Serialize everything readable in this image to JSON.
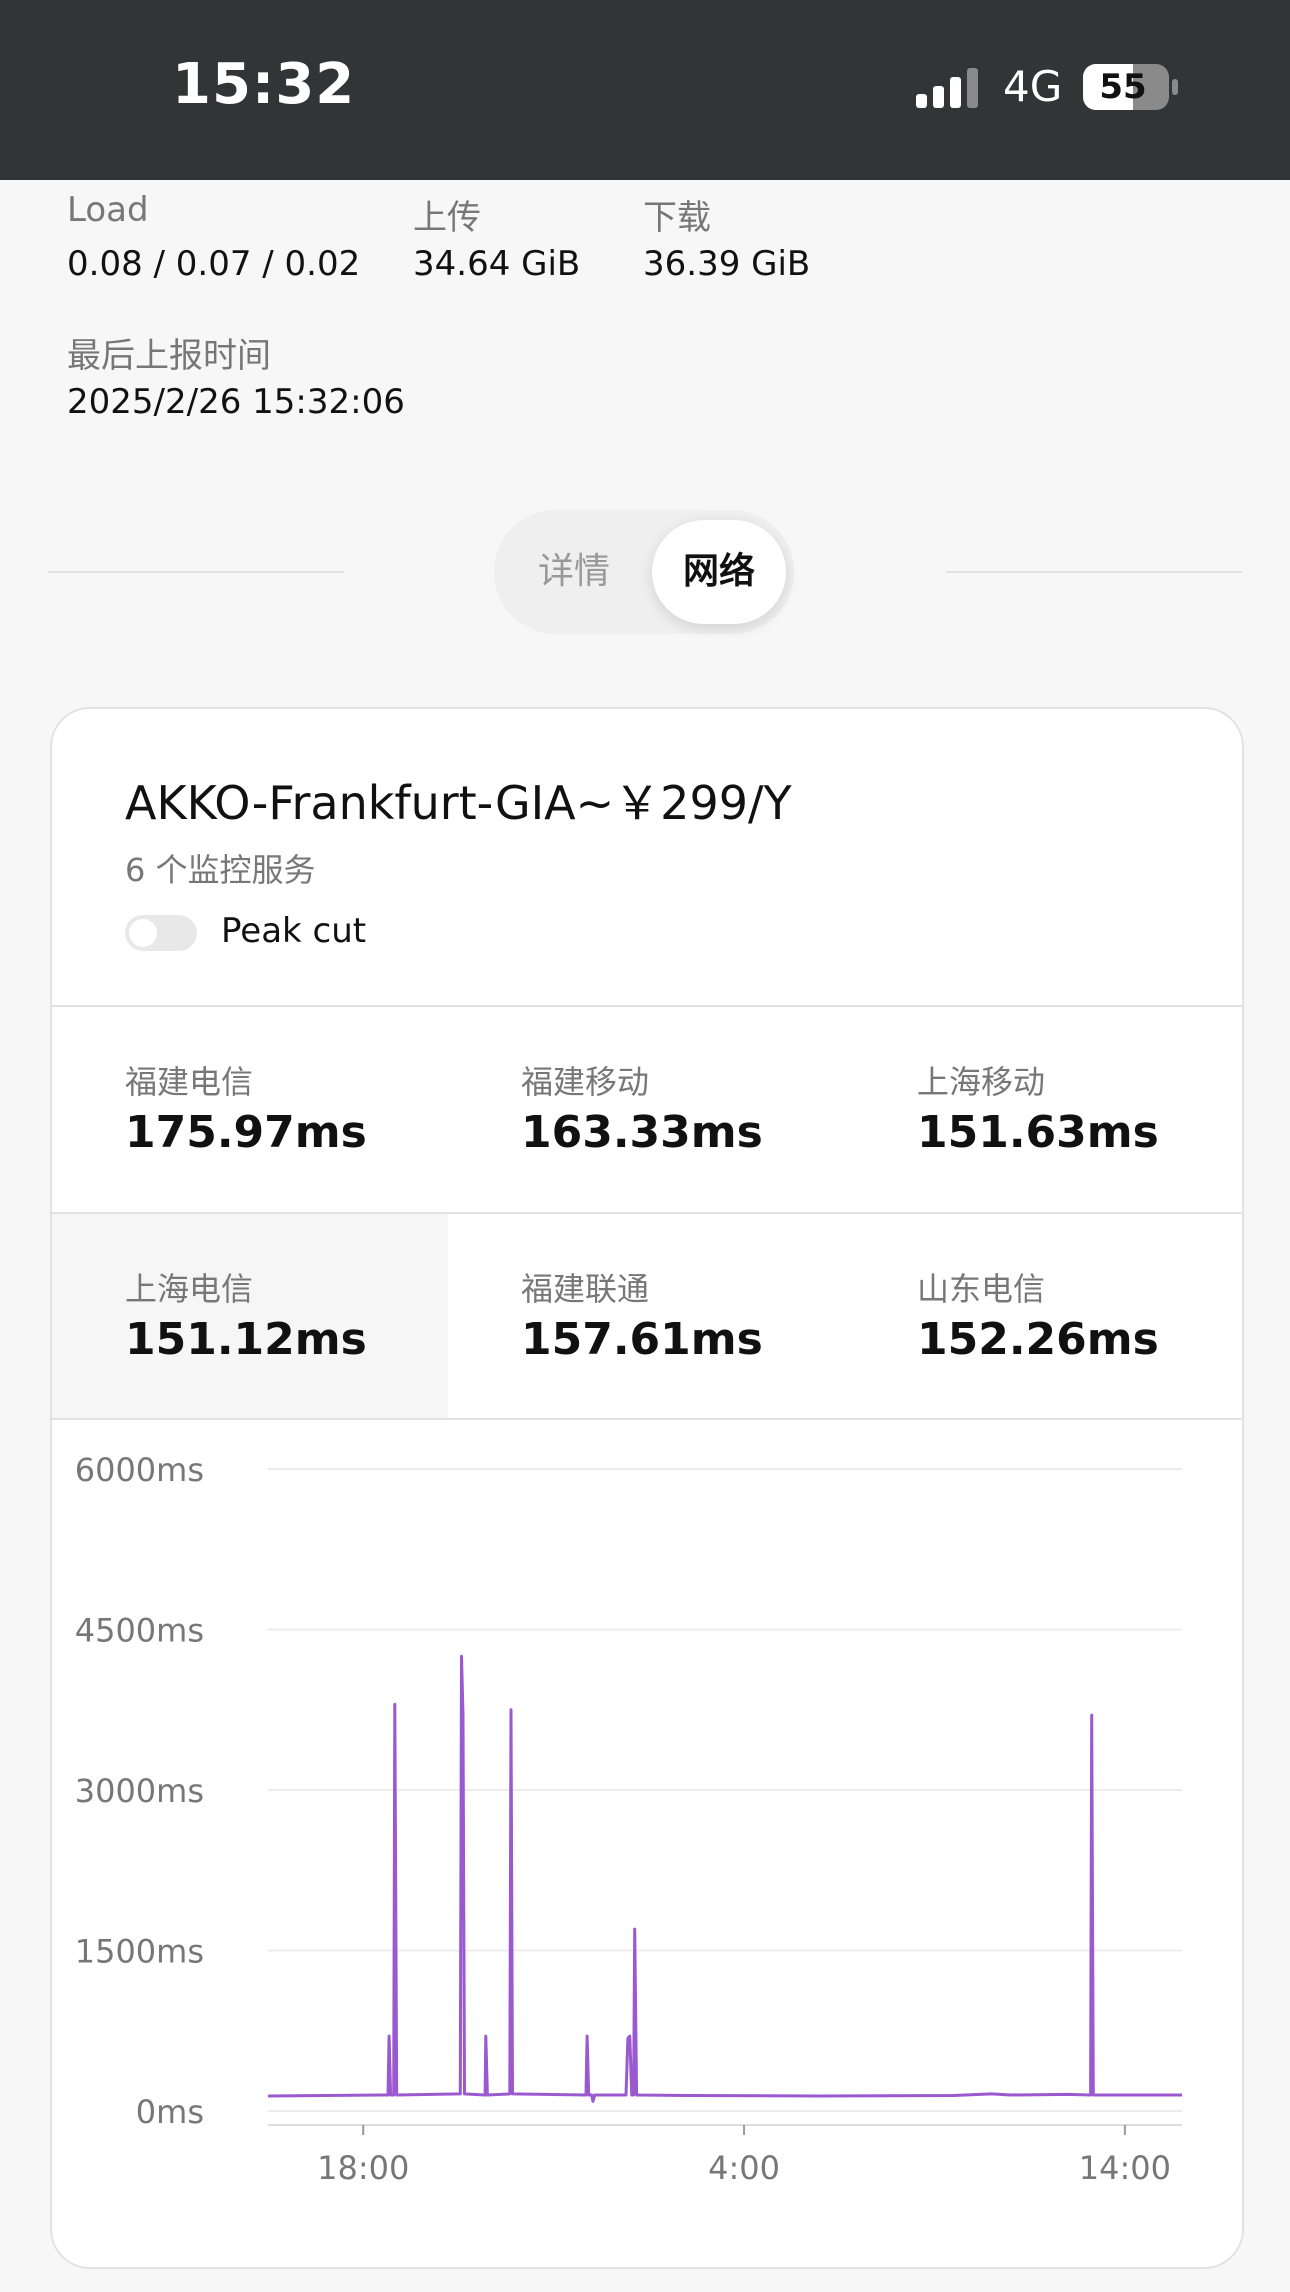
{
  "status_bar": {
    "time": "15:32",
    "network": "4G",
    "battery": "55"
  },
  "info": {
    "load_label": "Load",
    "load_value": "0.08 / 0.07 / 0.02",
    "upload_label": "上传",
    "upload_value": "34.64 GiB",
    "download_label": "下载",
    "download_value": "36.39 GiB",
    "last_report_label": "最后上报时间",
    "last_report_value": "2025/2/26 15:32:06"
  },
  "tabs": [
    {
      "label": "详情",
      "active": false
    },
    {
      "label": "网络",
      "active": true
    }
  ],
  "card": {
    "title": "AKKO-Frankfurt-GIA~￥299/Y",
    "subtitle": "6 个监控服务",
    "toggle_label": "Peak cut",
    "toggle_on": false,
    "services": [
      {
        "name": "福建电信",
        "value": "175.97ms",
        "active": false
      },
      {
        "name": "福建移动",
        "value": "163.33ms",
        "active": false
      },
      {
        "name": "上海移动",
        "value": "151.63ms",
        "active": false
      },
      {
        "name": "上海电信",
        "value": "151.12ms",
        "active": true
      },
      {
        "name": "福建联通",
        "value": "157.61ms",
        "active": false
      },
      {
        "name": "山东电信",
        "value": "152.26ms",
        "active": false
      }
    ]
  },
  "chart_data": {
    "type": "line",
    "ylim": [
      0,
      6000
    ],
    "y_ticks": [
      0,
      1500,
      3000,
      4500,
      6000
    ],
    "y_tick_labels": [
      "0ms",
      "1500ms",
      "3000ms",
      "4500ms",
      "6000ms"
    ],
    "x_ticks": [
      2.5,
      12.5,
      22.5
    ],
    "x_tick_labels": [
      "18:00",
      "4:00",
      "14:00"
    ],
    "xlim": [
      0,
      24
    ],
    "grid": true,
    "color": "#9b59d0",
    "series": [
      {
        "values": [
          [
            0,
            140
          ],
          [
            3.15,
            150
          ],
          [
            3.18,
            700
          ],
          [
            3.22,
            150
          ],
          [
            3.3,
            150
          ],
          [
            3.33,
            3800
          ],
          [
            3.38,
            150
          ],
          [
            5.05,
            160
          ],
          [
            5.08,
            4250
          ],
          [
            5.12,
            3700
          ],
          [
            5.16,
            160
          ],
          [
            5.7,
            150
          ],
          [
            5.72,
            700
          ],
          [
            5.76,
            150
          ],
          [
            6.35,
            160
          ],
          [
            6.38,
            3750
          ],
          [
            6.42,
            160
          ],
          [
            8.35,
            150
          ],
          [
            8.38,
            700
          ],
          [
            8.42,
            150
          ],
          [
            8.5,
            150
          ],
          [
            8.53,
            90
          ],
          [
            8.58,
            150
          ],
          [
            9.4,
            150
          ],
          [
            9.45,
            680
          ],
          [
            9.5,
            700
          ],
          [
            9.55,
            150
          ],
          [
            9.6,
            150
          ],
          [
            9.63,
            1700
          ],
          [
            9.68,
            150
          ],
          [
            11.0,
            145
          ],
          [
            14.5,
            140
          ],
          [
            18.0,
            145
          ],
          [
            19.0,
            160
          ],
          [
            19.5,
            150
          ],
          [
            21.0,
            155
          ],
          [
            21.6,
            150
          ],
          [
            21.63,
            3700
          ],
          [
            21.67,
            150
          ],
          [
            24,
            150
          ]
        ]
      }
    ]
  }
}
